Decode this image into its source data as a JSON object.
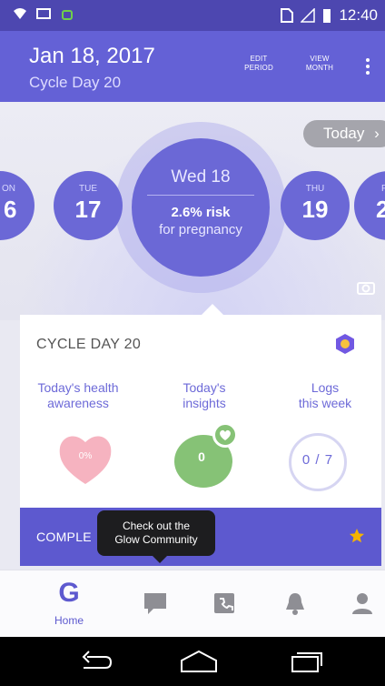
{
  "status_bar": {
    "time": "12:40"
  },
  "header": {
    "date": "Jan 18, 2017",
    "cycle_day": "Cycle Day 20",
    "edit_period_l1": "EDIT",
    "edit_period_l2": "PERIOD",
    "view_month_l1": "VIEW",
    "view_month_l2": "MONTH"
  },
  "calendar": {
    "days": [
      {
        "dow": "ON",
        "num": "6"
      },
      {
        "dow": "TUE",
        "num": "17"
      },
      {
        "dow": "THU",
        "num": "19"
      },
      {
        "dow": "F",
        "num": "2"
      }
    ],
    "selected": {
      "day_label": "Wed 18",
      "risk": "2.6% risk",
      "risk_note": "for pregnancy"
    },
    "today_button": "Today"
  },
  "card": {
    "title": "CYCLE DAY 20",
    "metrics": [
      {
        "label_l1": "Today's health",
        "label_l2": "awareness",
        "value": "0%"
      },
      {
        "label_l1": "Today's",
        "label_l2": "insights",
        "value": "0"
      },
      {
        "label_l1": "Logs",
        "label_l2": "this week",
        "value": "0 / 7"
      }
    ],
    "complete_text": "COMPLE"
  },
  "tooltip": {
    "line1": "Check out the",
    "line2": "Glow Community"
  },
  "bottom_nav": {
    "home_label": "Home",
    "home_glyph": "G"
  },
  "colors": {
    "primary": "#6461d6",
    "primary_dark": "#4d47b0",
    "insight_green": "#86c276",
    "heart_pink": "#f4a4b4",
    "star": "#f6b400"
  }
}
